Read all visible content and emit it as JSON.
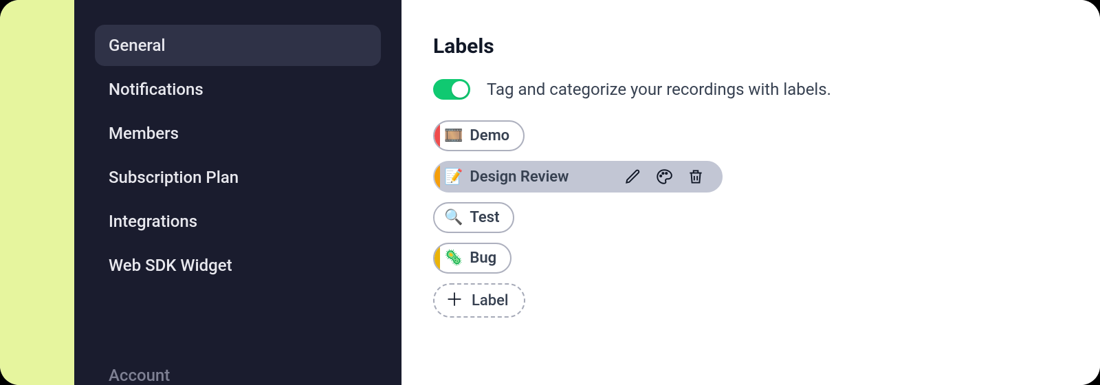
{
  "sidebar": {
    "items": [
      {
        "label": "General",
        "active": true
      },
      {
        "label": "Notifications",
        "active": false
      },
      {
        "label": "Members",
        "active": false
      },
      {
        "label": "Subscription Plan",
        "active": false
      },
      {
        "label": "Integrations",
        "active": false
      },
      {
        "label": "Web SDK Widget",
        "active": false
      }
    ],
    "footer_label": "Account"
  },
  "main": {
    "title": "Labels",
    "toggle_description": "Tag and categorize your recordings with labels.",
    "labels": [
      {
        "emoji": "🎞️",
        "name": "Demo",
        "stripe": "#ef4c4c",
        "hovered": false
      },
      {
        "emoji": "📝",
        "name": "Design Review",
        "stripe": "#f59e0b",
        "hovered": true
      },
      {
        "emoji": "🔍",
        "name": "Test",
        "stripe": "#ffffff",
        "hovered": false
      },
      {
        "emoji": "🦠",
        "name": "Bug",
        "stripe": "#eab308",
        "hovered": false
      }
    ],
    "add_label_text": "Label"
  }
}
